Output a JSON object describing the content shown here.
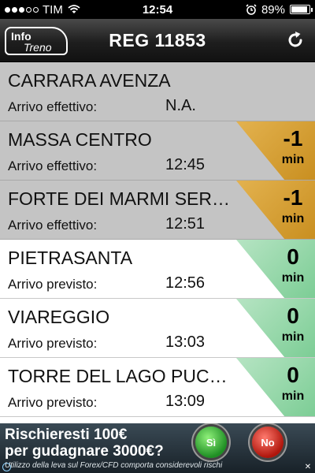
{
  "status_bar": {
    "carrier": "TIM",
    "time": "12:54",
    "battery": "89%",
    "battery_level": 0.89
  },
  "nav": {
    "logo_line1": "Info",
    "logo_line2": "Treno",
    "title": "REG 11853",
    "refresh_icon": "refresh-icon"
  },
  "stops": [
    {
      "station": "CARRARA AVENZA",
      "label": "Arrivo effettivo:",
      "time": "N.A.",
      "delay": "",
      "unit": "",
      "state": "past",
      "delay_state": ""
    },
    {
      "station": "MASSA CENTRO",
      "label": "Arrivo effettivo:",
      "time": "12:45",
      "delay": "-1",
      "unit": "min",
      "state": "past",
      "delay_state": "late"
    },
    {
      "station": "FORTE DEI MARMI SER…",
      "label": "Arrivo effettivo:",
      "time": "12:51",
      "delay": "-1",
      "unit": "min",
      "state": "past",
      "delay_state": "late"
    },
    {
      "station": "PIETRASANTA",
      "label": "Arrivo previsto:",
      "time": "12:56",
      "delay": "0",
      "unit": "min",
      "state": "future",
      "delay_state": "ontime"
    },
    {
      "station": "VIAREGGIO",
      "label": "Arrivo previsto:",
      "time": "13:03",
      "delay": "0",
      "unit": "min",
      "state": "future",
      "delay_state": "ontime"
    },
    {
      "station": "TORRE DEL LAGO PUC…",
      "label": "Arrivo previsto:",
      "time": "13:09",
      "delay": "0",
      "unit": "min",
      "state": "future",
      "delay_state": "ontime"
    },
    {
      "station": "",
      "label": "",
      "time": "",
      "delay": "",
      "unit": "",
      "state": "future",
      "delay_state": ""
    }
  ],
  "ad": {
    "line1": "Rischieresti 100€",
    "line2": "per gudagnare 3000€?",
    "line3": "Utilizzo della leva sul Forex/CFD comporta considerevoli rischi",
    "yes": "Sì",
    "no": "No"
  },
  "colors": {
    "late": "#d9a53a",
    "ontime": "#9fdcb0",
    "past_row": "#c4c4c4"
  }
}
